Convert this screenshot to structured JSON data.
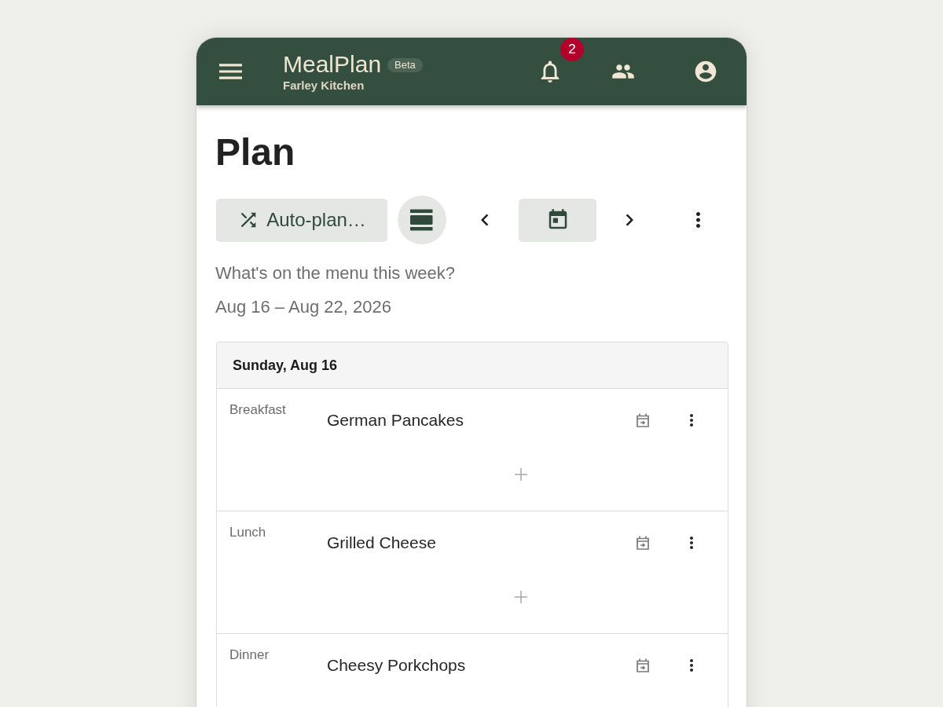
{
  "header": {
    "title": "MealPlan",
    "badge": "Beta",
    "subtitle": "Farley Kitchen",
    "actions": [
      {
        "kind": "notifications",
        "badge": "2"
      },
      {
        "kind": "people"
      },
      {
        "kind": "account"
      }
    ]
  },
  "page": {
    "title": "Plan",
    "toolbar": [
      {
        "kind": "auto-plan",
        "label": "Auto-plan…"
      },
      {
        "kind": "view-toggle"
      },
      {
        "kind": "previous"
      },
      {
        "kind": "date-picker"
      },
      {
        "kind": "next"
      },
      {
        "kind": "more"
      }
    ],
    "tagline": "What's on the menu this week?",
    "date_range": "Aug 16 – Aug 22, 2026"
  },
  "days": [
    {
      "label": "Sunday, Aug 16",
      "meals": [
        {
          "meal": "Breakfast",
          "recipe": "German Pancakes"
        },
        {
          "meal": "Lunch",
          "recipe": "Grilled Cheese"
        },
        {
          "meal": "Dinner",
          "recipe": "Cheesy Porkchops"
        }
      ]
    }
  ]
}
